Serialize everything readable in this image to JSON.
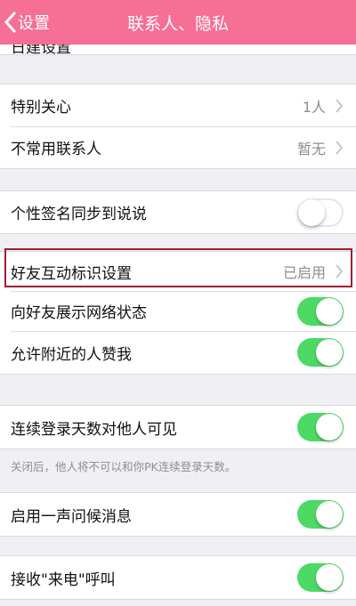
{
  "navbar": {
    "back_label": "设置",
    "title": "联系人、隐私"
  },
  "partial_row_label": "日建设置",
  "group1": {
    "items": [
      {
        "label": "特别关心",
        "value": "1人"
      },
      {
        "label": "不常用联系人",
        "value": "暂无"
      }
    ]
  },
  "group2": {
    "items": [
      {
        "label": "个性签名同步到说说",
        "toggle": "off"
      }
    ]
  },
  "group3": {
    "items": [
      {
        "label": "好友互动标识设置",
        "value": "已启用"
      },
      {
        "label": "向好友展示网络状态",
        "toggle": "on"
      },
      {
        "label": "允许附近的人赞我",
        "toggle": "on"
      }
    ]
  },
  "group4": {
    "items": [
      {
        "label": "连续登录天数对他人可见",
        "toggle": "on"
      }
    ],
    "footnote": "关闭后，他人将不可以和你PK连续登录天数。"
  },
  "group5": {
    "items": [
      {
        "label": "启用一声问候消息",
        "toggle": "on"
      }
    ]
  },
  "group6": {
    "items": [
      {
        "label": "接收\"来电\"呼叫",
        "toggle": "on"
      }
    ]
  },
  "colors": {
    "navbar": "#f56f96",
    "switch_on": "#4cd964",
    "highlight": "#a31d2e"
  },
  "icons": [
    "back-chevron-icon",
    "chevron-right-icon"
  ]
}
